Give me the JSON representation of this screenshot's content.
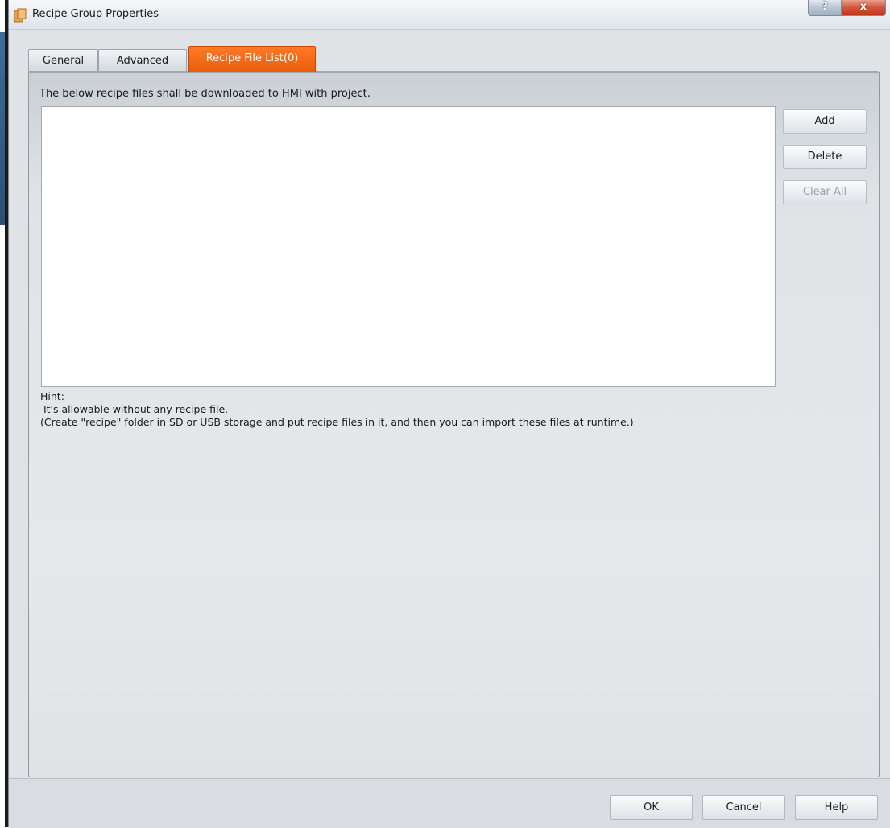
{
  "window": {
    "title": "Recipe Group Properties",
    "help_glyph": "?",
    "close_glyph": "x"
  },
  "tabs": [
    {
      "label": "General",
      "active": false
    },
    {
      "label": "Advanced",
      "active": false
    },
    {
      "label": "Recipe File List(0)",
      "active": true
    }
  ],
  "panel": {
    "header": "The below recipe files shall be downloaded to HMI with project.",
    "file_list": [],
    "buttons": {
      "add": "Add",
      "delete": "Delete",
      "clear_all": "Clear All"
    },
    "hint": {
      "title": "Hint:",
      "line1": " It's allowable without any recipe file.",
      "line2": "(Create \"recipe\" folder in SD or USB storage and put recipe files in it, and then you can import these files at runtime.)"
    }
  },
  "footer": {
    "ok": "OK",
    "cancel": "Cancel",
    "help": "Help"
  },
  "colors": {
    "active_tab": "#ff6a14",
    "window_bg": "#dfe3e6",
    "close_button": "#c7432a"
  },
  "icons": {
    "app": "app-icon",
    "help": "help-icon",
    "close": "close-icon"
  }
}
